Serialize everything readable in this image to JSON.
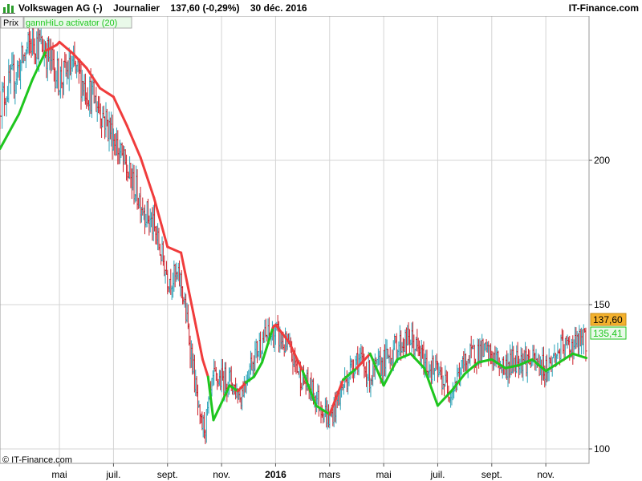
{
  "header": {
    "instrument": "Volkswagen AG (-)",
    "period": "Journalier",
    "last_change": "137,60 (-0,29%)",
    "date": "30 déc. 2016",
    "brand": "IT-Finance.com"
  },
  "legend": {
    "price_tag": "Prix",
    "indicator_tag": "gannHiLo activator (20)"
  },
  "copyright": "© IT-Finance.com",
  "colors": {
    "up_bar": "#29a3b8",
    "down_bar": "#cc1f28",
    "hilo_up": "#1ec61e",
    "hilo_down": "#f03c3c",
    "last_price_bg": "#f4b12c",
    "indicator_bg": "#e9f9e9",
    "grid": "#d4d4d4"
  },
  "chart_data": {
    "type": "line",
    "ylim": [
      95,
      250
    ],
    "y_ticks": [
      100,
      150,
      200
    ],
    "y_tick_labels": [
      "100",
      "150",
      "200"
    ],
    "x_ticks": [
      {
        "x": 4,
        "label": "mai",
        "bold": false
      },
      {
        "x": 6,
        "label": "juil.",
        "bold": false
      },
      {
        "x": 8,
        "label": "sept.",
        "bold": false
      },
      {
        "x": 10,
        "label": "nov.",
        "bold": false
      },
      {
        "x": 12,
        "label": "2016",
        "bold": true
      },
      {
        "x": 14,
        "label": "mars",
        "bold": false
      },
      {
        "x": 16,
        "label": "mai",
        "bold": false
      },
      {
        "x": 18,
        "label": "juil.",
        "bold": false
      },
      {
        "x": 20,
        "label": "sept.",
        "bold": false
      },
      {
        "x": 22,
        "label": "nov.",
        "bold": false
      }
    ],
    "xlim": [
      1.8,
      23.6
    ],
    "series": [
      {
        "role": "price",
        "x": [
          1.8,
          2.5,
          3.0,
          3.5,
          4.0,
          4.5,
          5.0,
          5.5,
          6.0,
          6.5,
          7.0,
          7.5,
          8.0,
          8.5,
          8.9,
          9.2,
          9.4,
          9.7,
          10.0,
          10.3,
          10.7,
          11.0,
          11.5,
          12.0,
          12.5,
          13.0,
          13.5,
          14.0,
          14.5,
          15.0,
          15.5,
          16.0,
          16.5,
          17.0,
          17.5,
          18.0,
          18.5,
          19.0,
          19.5,
          20.0,
          20.5,
          21.0,
          21.5,
          22.0,
          22.5,
          23.0,
          23.5
        ],
        "close": [
          220,
          232,
          242,
          238,
          228,
          232,
          225,
          218,
          208,
          196,
          186,
          176,
          160,
          158,
          132,
          108,
          108,
          124,
          124,
          124,
          118,
          128,
          138,
          140,
          134,
          124,
          118,
          110,
          122,
          132,
          125,
          130,
          136,
          138,
          130,
          126,
          120,
          130,
          134,
          132,
          128,
          132,
          130,
          128,
          134,
          136,
          137.6
        ]
      },
      {
        "name": "gannHiLo activator (20)",
        "x": [
          1.8,
          2.5,
          3.0,
          3.5,
          3.9,
          4.0,
          4.5,
          5.0,
          5.5,
          6.0,
          6.5,
          7.0,
          7.5,
          8.0,
          8.5,
          9.0,
          9.3,
          9.5,
          9.7,
          10.0,
          10.3,
          10.6,
          10.9,
          11.2,
          11.5,
          11.9,
          12.0,
          12.5,
          13.0,
          13.5,
          14.0,
          14.5,
          15.0,
          15.5,
          16.0,
          16.5,
          17.0,
          17.5,
          18.0,
          18.5,
          19.0,
          19.5,
          20.0,
          20.5,
          21.0,
          21.5,
          22.0,
          22.5,
          23.0,
          23.5
        ],
        "values": [
          204,
          216,
          228,
          238,
          240,
          241,
          237,
          232,
          225,
          222,
          212,
          201,
          187,
          170,
          168,
          145,
          131,
          125,
          110,
          116,
          122,
          120,
          123,
          125,
          130,
          142,
          143,
          137,
          127,
          115,
          112,
          124,
          128,
          133,
          122,
          131,
          133,
          128,
          115,
          120,
          126,
          130,
          131,
          128,
          129,
          131,
          127,
          130,
          133,
          131.5
        ]
      }
    ],
    "last_price_label": "137,60",
    "last_indicator_label": "135,41"
  }
}
